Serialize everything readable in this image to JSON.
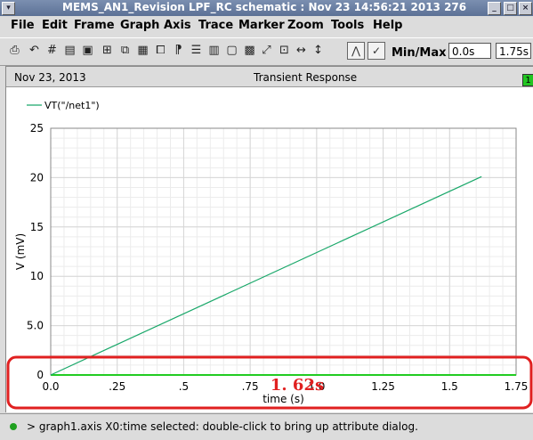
{
  "window": {
    "title": "MEMS_AN1_Revision LPF_RC schematic : Nov 23 14:56:21 2013 276"
  },
  "menu": [
    "File",
    "Edit",
    "Frame",
    "Graph",
    "Axis",
    "Trace",
    "Marker",
    "Zoom",
    "Tools",
    "Help"
  ],
  "toolbar": {
    "minmax_label": "Min/Max",
    "min_value": "0.0s",
    "max_value": "1.75s"
  },
  "graph_header": {
    "date": "Nov 23, 2013",
    "title": "Transient Response",
    "badge": "1"
  },
  "annotation": {
    "text": "1. 62s",
    "color": "#e02020"
  },
  "status": {
    "text": "> graph1.axis X0:time selected: double-click to bring up attribute dialog."
  },
  "chart_data": {
    "type": "line",
    "title": "Transient Response",
    "xlabel": "time (s)",
    "ylabel": "V (mV)",
    "xlim": [
      0.0,
      1.75
    ],
    "ylim": [
      0,
      25
    ],
    "x_ticks": [
      0.0,
      0.25,
      0.5,
      0.75,
      1.0,
      1.25,
      1.5,
      1.75
    ],
    "x_tick_labels": [
      "0.0",
      ".25",
      ".5",
      ".75",
      "1.0",
      "1.25",
      "1.5",
      "1.75"
    ],
    "y_ticks": [
      0,
      5,
      10,
      15,
      20,
      25
    ],
    "y_tick_labels": [
      "0",
      "5.0",
      "10",
      "15",
      "20",
      "25"
    ],
    "grid": true,
    "legend": "top-left",
    "series": [
      {
        "name": "VT(\"/net1\")",
        "color": "#1aa86a",
        "x": [
          0.0,
          1.62
        ],
        "y": [
          0.0,
          20.1
        ]
      }
    ],
    "reference_line": {
      "y": 0,
      "color": "#22cc22"
    }
  }
}
